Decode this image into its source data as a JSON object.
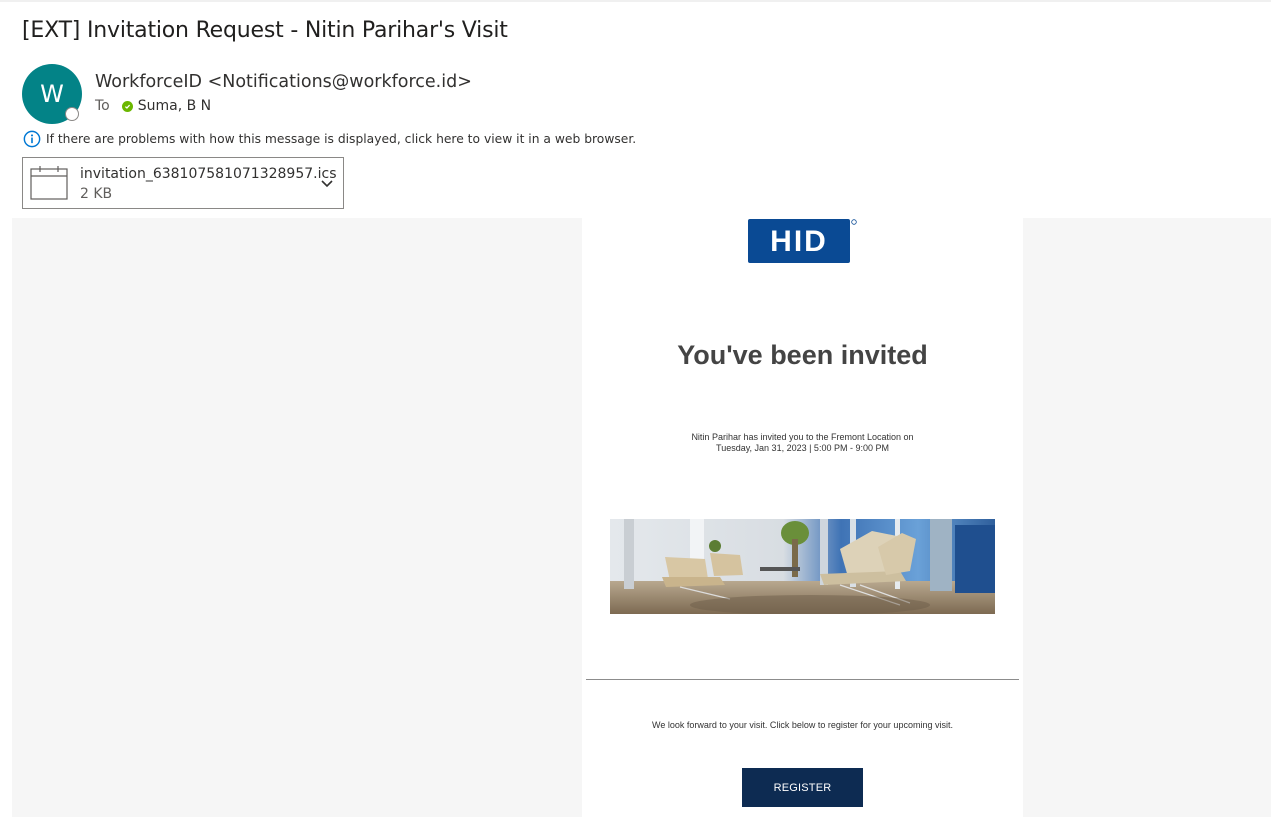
{
  "message": {
    "subject": "[EXT] Invitation Request - Nitin Parihar's Visit",
    "avatar_initial": "W",
    "sender": "WorkforceID <Notifications@workforce.id>",
    "to_label": "To",
    "recipient": "Suma, B N",
    "info_notice": "If there are problems with how this message is displayed, click here to view it in a web browser."
  },
  "attachment": {
    "filename": "invitation_638107581071328957.ics",
    "size": "2 KB"
  },
  "email": {
    "logo_text": "HID",
    "heading": "You've been invited",
    "invite_line1": "Nitin Parihar has invited you to the Fremont Location on",
    "invite_line2": "Tuesday, Jan 31, 2023 | 5:00 PM - 9:00 PM",
    "forward_text": "We look forward to your visit. Click below to register for your upcoming visit.",
    "register_label": "REGISTER"
  },
  "colors": {
    "avatar": "#038387",
    "hid_blue": "#0a4a94",
    "button": "#0d2b52",
    "presence_ok": "#6bb700",
    "info_blue": "#0078d4"
  },
  "icons": {
    "info": "info-icon",
    "calendar": "calendar-icon",
    "chevron": "chevron-down-icon",
    "presence": "presence-available-icon"
  }
}
